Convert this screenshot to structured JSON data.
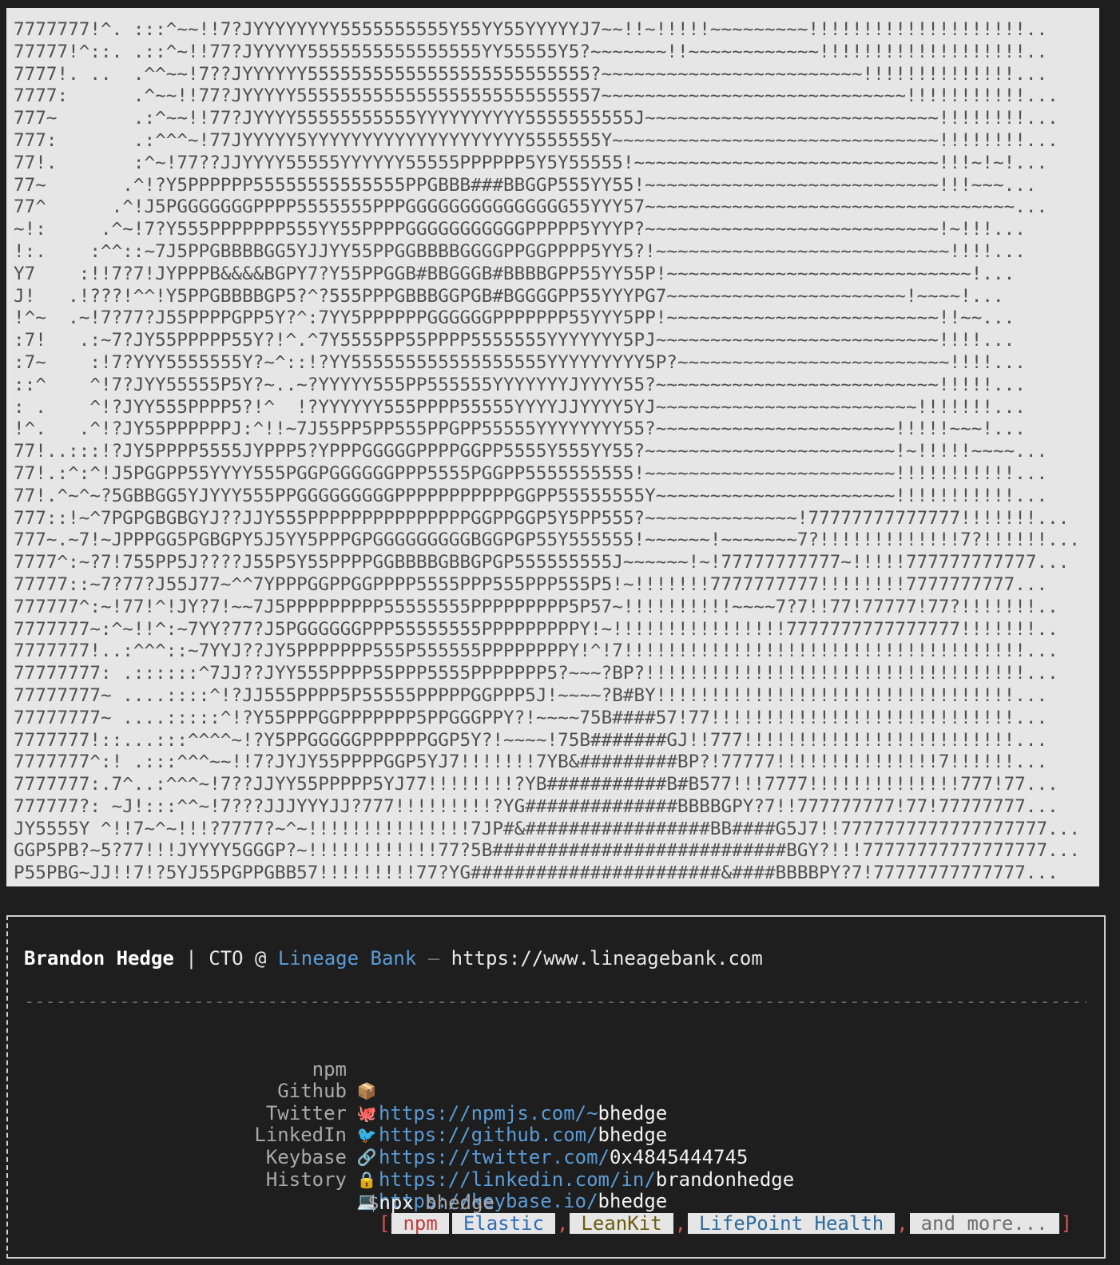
{
  "ascii_art": {
    "lines": [
      "7777777!^. :::^~~!!7?JYYYYYYYY5555555555Y55YY55YYYYYJ7~~!!~!!!!!~~~~~~~~~!!!!!!!!!!!!!!!!!!!!..",
      "77777!^::. .::^~!!77?JYYYYY5555555555555555YY55555Y5?~~~~~~~!!~~~~~~~~~~~~!!!!!!!!!!!!!!!!!!!..",
      "7777!. ..  .^^~~!7??JYYYYYY55555555555555555555555555?~~~~~~~~~~~~~~~~~~~~~~~~!!!!!!!!!!!!!!...",
      "7777:      .^~~!!77?JYYYYY5555555555555555555555555557~~~~~~~~~~~~~~~~~~~~~~~~~~~~!!!!!!!!!!!...",
      "777~       .:^~~!!77?JYYYY55555555555YYYYYYYYYY5555555555J~~~~~~~~~~~~~~~~~~~~~~~~~~~!!!!!!!!...",
      "777:       .:^^^~!77JYYYYY5YYYYYYYYYYYYYYYYYYYY5555555Y~~~~~~~~~~~~~~~~~~~~~~~~~~~~~~!!!!!!!!...",
      "77!.       :^~!77??JJYYYY55555YYYYYY55555PPPPPP5Y5Y55555!~~~~~~~~~~~~~~~~~~~~~~~~~~~~!!!~!~!...",
      "77~       .^!?Y5PPPPPP55555555555555PPGBBB###BBGGP555YY55!~~~~~~~~~~~~~~~~~~~~~~~~~~~!!!~~~...",
      "77^      .^!J5PGGGGGGGPPPP5555555PPPGGGGGGGGGGGGGGG55YYY57~~~~~~~~~~~~~~~~~~~~~~~~~~~~~~~~~~...",
      "~!:     .^~!7?Y555PPPPPPP555YY55PPPPGGGGGGGGGGGPPPPP5YYYP?~~~~~~~~~~~~~~~~~~~~~~~~~~~!~!!!...",
      "!:.    :^^::~7J5PPGBBBBGG5YJJYY55PPGGBBBBGGGGPPGGPPPP5YY5?!~~~~~~~~~~~~~~~~~~~~~~~~~~~!!!!...",
      "Y7    :!!7?7!JYPPPB&&&&BGPY7?Y55PPGGB#BBGGGB#BBBBGPP55YY55P!~~~~~~~~~~~~~~~~~~~~~~~~~~~~!...",
      "J!   .!???!^^!Y5PPGBBBBGP5?^?555PPPGBBBGGPGB#BGGGGPP55YYYPG7~~~~~~~~~~~~~~~~~~~~~~!~~~~!...",
      "!^~  .~!7?77?J55PPPPGPP5Y?^:7YY5PPPPPPGGGGGGPPPPPPP55YYY5PP!~~~~~~~~~~~~~~~~~~~~~~~~~!!~~...",
      ":7!   .:~7?JY55PPPPP55Y?!^.^7Y5555PP55PPPP5555555YYYYYYY5PJ~~~~~~~~~~~~~~~~~~~~~~~~~~!!!!...",
      ":7~    :!7?YYY5555555Y?~^::!?YY555555555555555555YYYYYYYYY5P?~~~~~~~~~~~~~~~~~~~~~~~~~!!!!...",
      "::^    ^!7?JYY55555P5Y?~..~?YYYYY555PP555555YYYYYYYJYYYY55?~~~~~~~~~~~~~~~~~~~~~~~~~~!!!!!...",
      ": .    ^!?JYY555PPPP5?!^  !?YYYYYY555PPPP55555YYYYJJYYYY5YJ~~~~~~~~~~~~~~~~~~~~~~~~!!!!!!!...",
      "!^.   .^!?JY55PPPPPPJ:^!!~7J55PP5PP555PPGPP55555YYYYYYYY55?~~~~~~~~~~~~~~~~~~~~~~!!!!!~~~!...",
      "77!..:::!?JY5PPPP5555JYPPP5?YPPPGGGGGPPPPGGPP5555Y555YY55?~~~~~~~~~~~~~~~~~~~~~~~!~!!!!!~~~~...",
      "77!.:^:^!J5PGGPP55YYYY555PGGPGGGGGGPPP5555PGGPP5555555555!~~~~~~~~~~~~~~~~~~~~~~~!!!!!!!!!!!...",
      "77!.^~^~?5GBBGG5YJYYY555PPGGGGGGGGGPPPPPPPPPPPGGPP55555555Y~~~~~~~~~~~~~~~~~~~~~~!!!!!!!!!!!...",
      "777::!~^7PGPGBGBGYJ??JJY555PPPPPPPPPPPPPPPGGPPGGP5Y5PP555?~~~~~~~~~~~~~~!77777777777777!!!!!!!...",
      "777~.~7!~JPPPGG5PGBGPY5J5YY5PPPGPGGGGGGGGGBGGPGP55Y555555!~~~~~~!~~~~~~~7?!!!!!!!!!!!!!7?!!!!!!...",
      "7777^:~?7!755PP5J????J55P5Y55PPPPGGBBBBGBBGPGP555555555J~~~~~~!~!77777777777~!!!!!777777777777...",
      "77777::~7?77?J55J77~^^7YPPPGGPPGGPPPP5555PPP555PPP555P5!~!!!!!!!7777777777!!!!!!!!7777777777...",
      "777777^:~!77!^!JY?7!~~7J5PPPPPPPPP55555555PPPPPPPPP5P57~!!!!!!!!!!~~~~7?7!!77!77777!77?!!!!!!!..",
      "7777777~:^~!!^:~7YY?77?J5PGGGGGGPPP55555555PPPPPPPPPY!~!!!!!!!!!!!!!!!!7777777777777777!!!!!!!..",
      "7777777!..:^^^::~7YYJ??JY5PPPPPPP555P555555PPPPPPPPY!^!7!!!!!!!!!!!!!!!!!!!!!!!!!!!!!!!!!!!!!...",
      "77777777: .::::::^7JJ??JYY555PPPP55PPP5555PPPPPPP5?~~~?BP?!!!!!!!!!!!!!!!!!!!!!!!!!!!!!!!!!!!...",
      "77777777~ ....::::^!?JJ555PPPP5P55555PPPPPGGPPP5J!~~~~?B#BY!!!!!!!!!!!!!!!!!!!!!!!!!!!!!!!!!...",
      "77777777~ ....:::::^!?Y55PPPGGPPPPPPP5PPGGGPPY?!~~~~75B####57!77!!!!!!!!!!!!!!!!!!!!!!!!!!!!...",
      "7777777!::...:::^^^^~!?Y5PPGGGGGPPPPPPGGP5Y?!~~~~!75B#######GJ!!777!!!!!!!!!!!!!!!!!!!!!!!!!...",
      "7777777^:! .:::^^^~~!!7?JYJY55PPPPGGP5YJ7!!!!!!!7YB&#########BP?!77777!!!!!!!!!!!!!!!7!!!!!!...",
      "7777777:.7^..:^^^~!7??JJYY55PPPPP5YJ77!!!!!!!!?YB###########B#B577!!!7777!!!!!!!!!!!!!!777!77...",
      "777777?: ~J!:::^^~!7???JJJYYYJJ?777!!!!!!!!!?YG##############BBBBGPY?7!!777777777!77!77777777...",
      "JY5555Y ^!!7~^~!!!?7777?~^~!!!!!!!!!!!!!!!7JP#&#################BB####G5J7!!7777777777777777777...",
      "GGP5PB?~5?77!!!JYYYY5GGGP?~!!!!!!!!!!!!77?5B###########################BGY?!!!77777777777777777...",
      "P55PBG~JJ!!7!?5YJ55PGPPGBB57!!!!!!!!!77?YG#######################&####BBBBPY?7!77777777777777..."
    ]
  },
  "card": {
    "name": "Brandon Hedge",
    "separator": " | ",
    "role": "CTO @ ",
    "company": "Lineage Bank",
    "dash": " – ",
    "website": "https://www.lineagebank.com",
    "divider": "--------------------------------------------------------------------------------------------------------------------------------------------------------------------------------------------------",
    "links": [
      {
        "label": "npm",
        "icon": "📦",
        "icon_name": "package-icon",
        "url": "https://npmjs.com/~",
        "handle": "bhedge"
      },
      {
        "label": "Github",
        "icon": "🐙",
        "icon_name": "octopus-icon",
        "url": "https://github.com/",
        "handle": "bhedge"
      },
      {
        "label": "Twitter",
        "icon": "🐦",
        "icon_name": "bird-icon",
        "url": "https://twitter.com/",
        "handle": "0x4845444745"
      },
      {
        "label": "LinkedIn",
        "icon": "🔗",
        "icon_name": "link-icon",
        "url": "https://linkedin.com/in/",
        "handle": "brandonhedge"
      },
      {
        "label": "Keybase",
        "icon": "🔒",
        "icon_name": "lock-icon",
        "url": "https://keybase.io/",
        "handle": "bhedge"
      }
    ],
    "history": {
      "label": "History",
      "icon": "💻",
      "icon_name": "laptop-icon",
      "open_bracket": "[",
      "close_bracket": "]",
      "comma": ",",
      "items": [
        "npm",
        "Elastic",
        "LeanKit",
        "LifePoint Health",
        "and more..."
      ]
    },
    "npx": {
      "dollar": "$",
      "command": "npx",
      "arg": " bhedge"
    }
  }
}
